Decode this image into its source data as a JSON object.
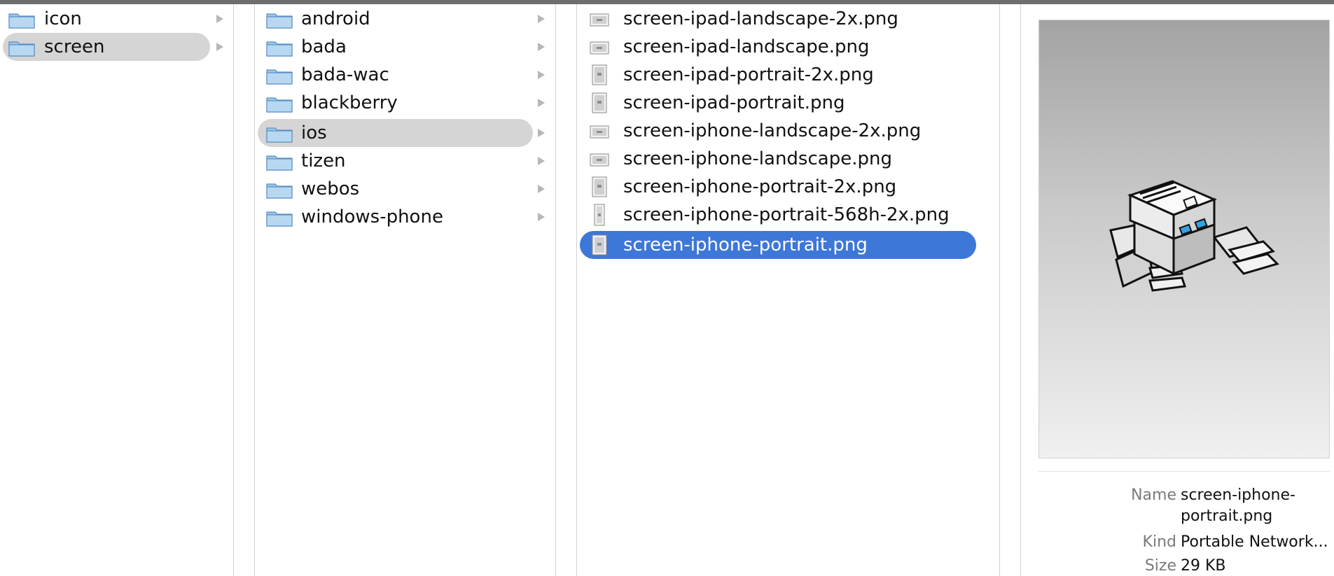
{
  "column1": {
    "items": [
      {
        "label": "icon",
        "selected": false
      },
      {
        "label": "screen",
        "selected": true
      }
    ]
  },
  "column2": {
    "items": [
      {
        "label": "android",
        "selected": false
      },
      {
        "label": "bada",
        "selected": false
      },
      {
        "label": "bada-wac",
        "selected": false
      },
      {
        "label": "blackberry",
        "selected": false
      },
      {
        "label": "ios",
        "selected": true
      },
      {
        "label": "tizen",
        "selected": false
      },
      {
        "label": "webos",
        "selected": false
      },
      {
        "label": "windows-phone",
        "selected": false
      }
    ]
  },
  "column3": {
    "items": [
      {
        "label": "screen-ipad-landscape-2x.png",
        "icon": "landscape-image-file-icon"
      },
      {
        "label": "screen-ipad-landscape.png",
        "icon": "landscape-image-file-icon"
      },
      {
        "label": "screen-ipad-portrait-2x.png",
        "icon": "portrait-image-file-icon"
      },
      {
        "label": "screen-ipad-portrait.png",
        "icon": "portrait-image-file-icon"
      },
      {
        "label": "screen-iphone-landscape-2x.png",
        "icon": "landscape-image-file-icon"
      },
      {
        "label": "screen-iphone-landscape.png",
        "icon": "landscape-image-file-icon"
      },
      {
        "label": "screen-iphone-portrait-2x.png",
        "icon": "portrait-image-file-icon"
      },
      {
        "label": "screen-iphone-portrait-568h-2x.png",
        "icon": "tall-portrait-image-file-icon"
      },
      {
        "label": "screen-iphone-portrait.png",
        "icon": "portrait-image-file-icon",
        "selected": true
      }
    ]
  },
  "preview": {
    "image_icon": "robot-preview-image",
    "name_key": "Name",
    "name_line1": "screen-iphone-",
    "name_line2": "portrait.png",
    "kind_key": "Kind",
    "kind_value": "Portable Network...",
    "size_key": "Size",
    "size_value": "29 KB"
  },
  "colors": {
    "selection_blue": "#3d77d8",
    "selection_gray": "#d5d5d5",
    "folder_blue": "#9cc6ea"
  }
}
